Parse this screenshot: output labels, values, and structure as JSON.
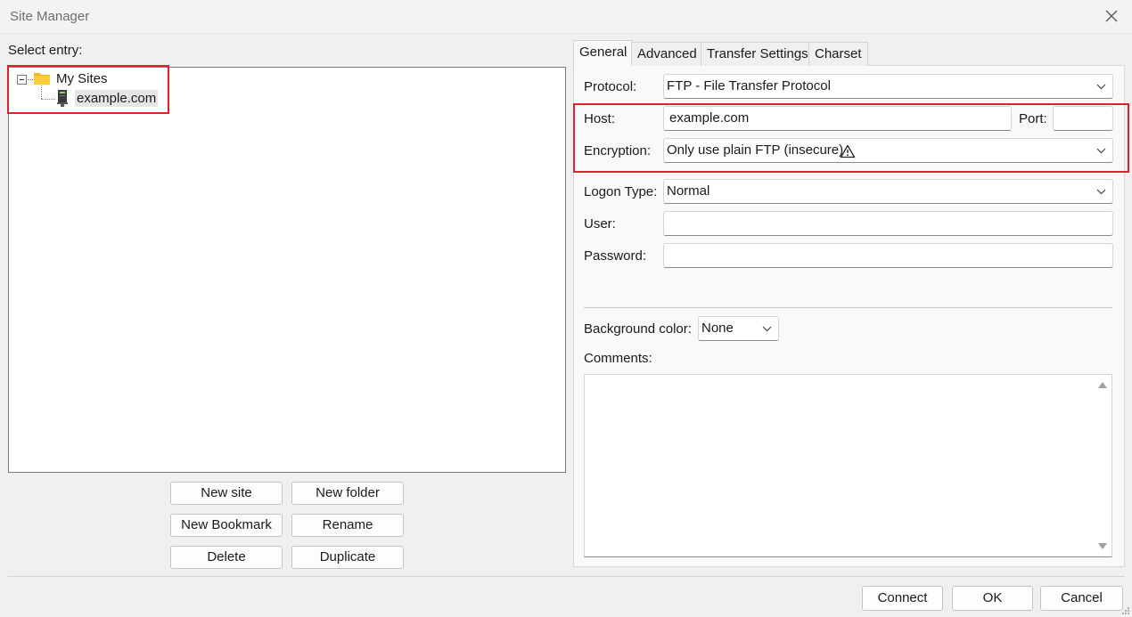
{
  "window": {
    "title": "Site Manager"
  },
  "left": {
    "select_label": "Select entry:",
    "tree": {
      "root": {
        "label": "My Sites",
        "icon": "folder-icon",
        "expanded": true
      },
      "site": {
        "label": "example.com",
        "icon": "server-icon",
        "selected": true
      }
    },
    "buttons": {
      "new_site": "New site",
      "new_folder": "New folder",
      "new_bookmark": "New Bookmark",
      "rename": "Rename",
      "delete": "Delete",
      "duplicate": "Duplicate"
    }
  },
  "tabs": [
    {
      "label": "General",
      "active": true
    },
    {
      "label": "Advanced",
      "active": false
    },
    {
      "label": "Transfer Settings",
      "active": false
    },
    {
      "label": "Charset",
      "active": false
    }
  ],
  "general": {
    "protocol": {
      "label": "Protocol:",
      "value": "FTP - File Transfer Protocol"
    },
    "host": {
      "label": "Host:",
      "value": "example.com"
    },
    "port": {
      "label": "Port:",
      "value": ""
    },
    "encryption": {
      "label": "Encryption:",
      "value": "Only use plain FTP (insecure)",
      "warning_icon": "warning-icon"
    },
    "logon_type": {
      "label": "Logon Type:",
      "value": "Normal"
    },
    "user": {
      "label": "User:",
      "value": ""
    },
    "password": {
      "label": "Password:",
      "value": ""
    },
    "background_color": {
      "label": "Background color:",
      "value": "None"
    },
    "comments": {
      "label": "Comments:",
      "value": ""
    }
  },
  "footer": {
    "connect": "Connect",
    "ok": "OK",
    "cancel": "Cancel"
  },
  "colors": {
    "highlight_border": "#e0202a",
    "folder": "#f2b91a",
    "selection_bg": "#e5e5e5"
  }
}
